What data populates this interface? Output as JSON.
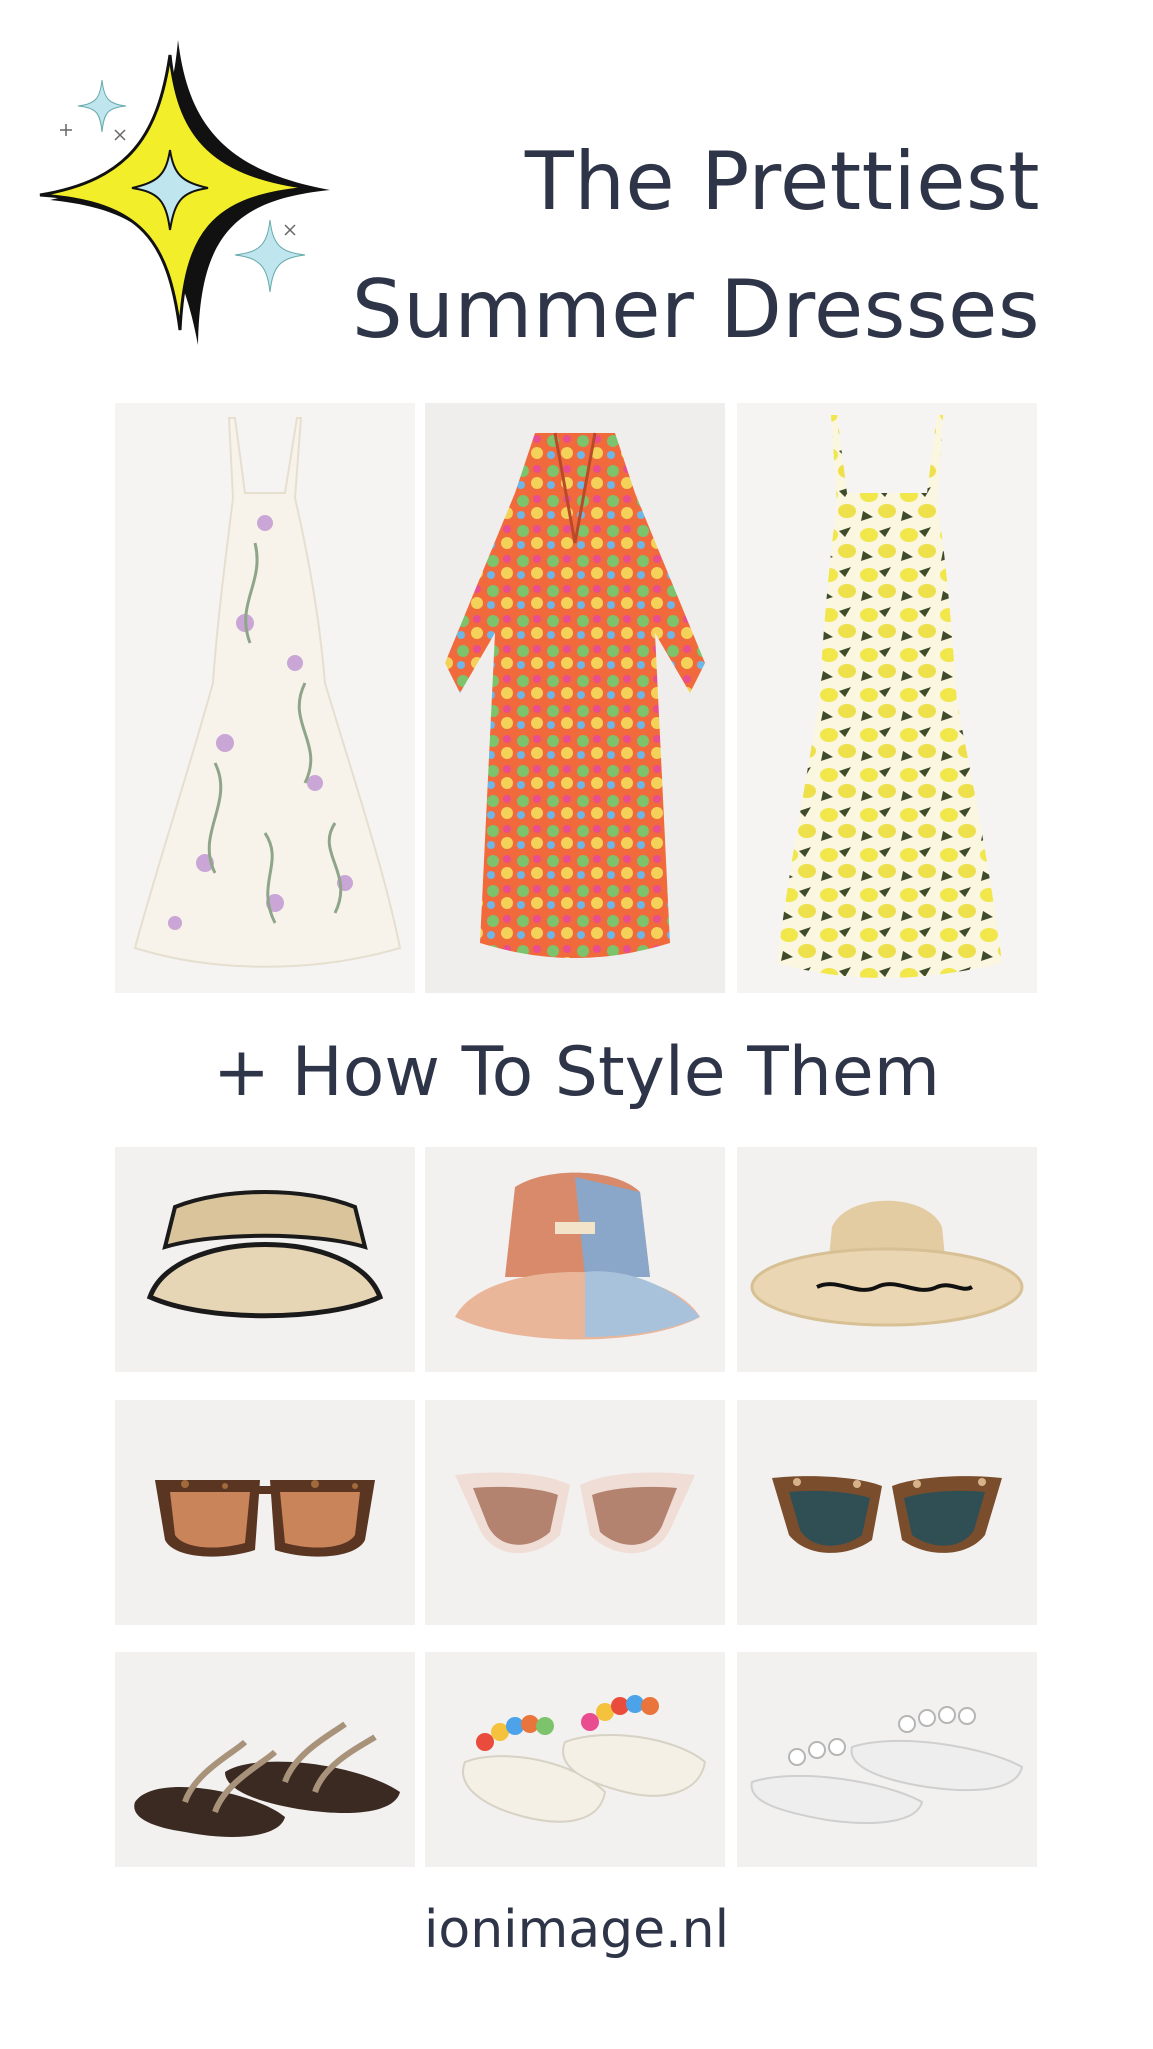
{
  "header": {
    "title_line1": "The Prettiest",
    "title_line2": "Summer Dresses"
  },
  "subtitle": "+ How To Style Them",
  "footer": {
    "site": "ionimage.nl"
  },
  "dresses": [
    {
      "name": "white-floral-maxi-dress"
    },
    {
      "name": "orange-multicolor-kaftan-dress"
    },
    {
      "name": "yellow-lemon-print-maxi-dress"
    }
  ],
  "hats": [
    {
      "name": "straw-visor"
    },
    {
      "name": "patchwork-bucket-hat"
    },
    {
      "name": "straw-sun-hat"
    }
  ],
  "sunglasses": [
    {
      "name": "tortoise-square-sunglasses"
    },
    {
      "name": "pink-cat-eye-sunglasses"
    },
    {
      "name": "tortoise-cat-eye-sunglasses"
    }
  ],
  "sandals": [
    {
      "name": "brown-strappy-sandals"
    },
    {
      "name": "beaded-toe-post-sandals"
    },
    {
      "name": "clear-embellished-sandals"
    }
  ],
  "colors": {
    "text": "#2f3548",
    "tile_bg": "#f2f1f0",
    "star_yellow": "#f3ee2a",
    "star_blue": "#bfe6ef"
  }
}
